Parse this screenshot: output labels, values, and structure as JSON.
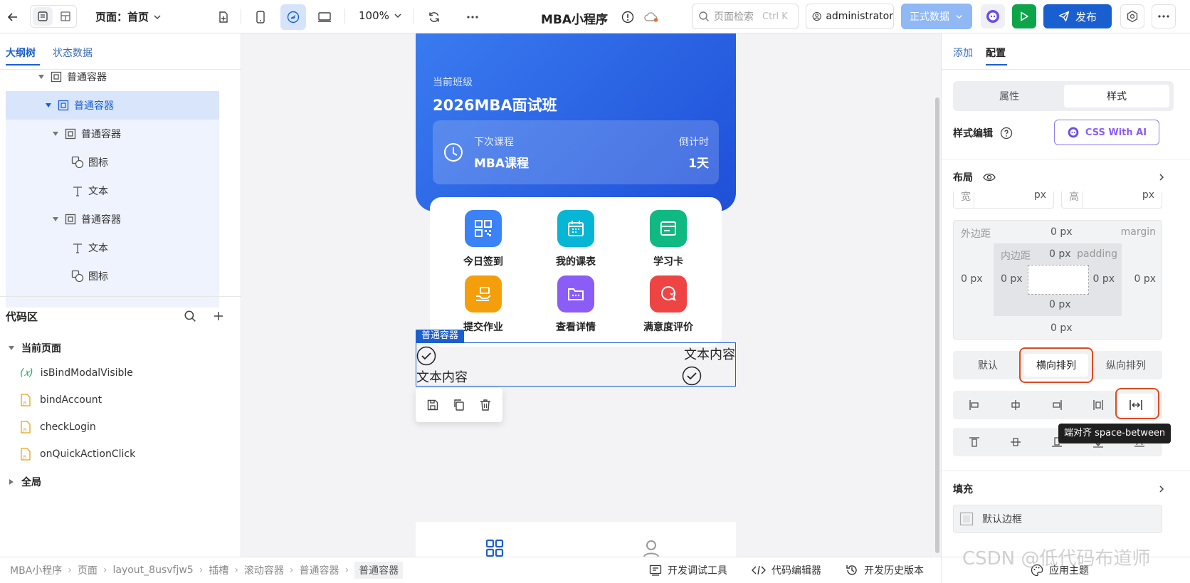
{
  "topbar": {
    "page_label": "页面：首页",
    "zoom": "100%",
    "app_title": "MBA小程序",
    "search_placeholder": "页面检索",
    "search_shortcut": "Ctrl K",
    "user": "administrator",
    "env": "正式数据",
    "publish": "发布"
  },
  "left": {
    "tabs": [
      "大纲树",
      "状态数据"
    ],
    "tree": [
      {
        "label": "普通容器",
        "icon": "container-icon"
      },
      {
        "label": "普通容器",
        "icon": "container-icon"
      },
      {
        "label": "普通容器",
        "icon": "container-icon"
      },
      {
        "label": "图标",
        "icon": "shapes-icon"
      },
      {
        "label": "文本",
        "icon": "text-icon"
      },
      {
        "label": "普通容器",
        "icon": "container-icon"
      },
      {
        "label": "文本",
        "icon": "text-icon"
      },
      {
        "label": "图标",
        "icon": "shapes-icon"
      }
    ],
    "code_title": "代码区",
    "code_page": "当前页面",
    "code_items": [
      {
        "label": "isBindModalVisible",
        "icon": "variable-icon"
      },
      {
        "label": "bindAccount",
        "icon": "js-file-icon"
      },
      {
        "label": "checkLogin",
        "icon": "js-file-icon"
      },
      {
        "label": "onQuickActionClick",
        "icon": "js-file-icon"
      }
    ],
    "code_global": "全局"
  },
  "canvas": {
    "class_label": "当前班级",
    "class_name": "2026MBA面试班",
    "next_label": "下次课程",
    "next_value": "MBA课程",
    "countdown_label": "倒计时",
    "countdown_value": "1天",
    "actions": [
      {
        "label": "今日签到",
        "color": "#3b82f6",
        "icon": "qrcode-icon"
      },
      {
        "label": "我的课表",
        "color": "#06b6d4",
        "icon": "calendar-icon"
      },
      {
        "label": "学习卡",
        "color": "#10b981",
        "icon": "card-icon"
      },
      {
        "label": "提交作业",
        "color": "#f59e0b",
        "icon": "submit-icon"
      },
      {
        "label": "查看详情",
        "color": "#8b5cf6",
        "icon": "folder-icon"
      },
      {
        "label": "满意度评价",
        "color": "#ef4444",
        "icon": "chat-icon"
      }
    ],
    "selected_tag": "普通容器",
    "text_content": "文本内容"
  },
  "right": {
    "tabs": [
      "添加",
      "配置"
    ],
    "seg": [
      "属性",
      "样式"
    ],
    "style_edit": "样式编辑",
    "css_ai": "CSS With AI",
    "layout": "布局",
    "width_label": "宽",
    "height_label": "高",
    "unit": "px",
    "margin_cn": "外边距",
    "margin_en": "margin",
    "padding_cn": "内边距",
    "padding_en": "padding",
    "zero_px": "0 px",
    "dir": [
      "默认",
      "横向排列",
      "纵向排列"
    ],
    "tooltip": "端对齐 space-between",
    "fill": "填充",
    "border": "默认边框"
  },
  "status": {
    "crumbs": [
      "MBA小程序",
      "页面",
      "layout_8usvfjw5",
      "插槽",
      "滚动容器",
      "普通容器",
      "普通容器"
    ],
    "devtools": "开发调试工具",
    "code_editor": "代码编辑器",
    "history": "开发历史版本",
    "theme": "应用主题",
    "watermark": "CSDN @低代码布道师"
  },
  "colors": {
    "primary": "#1a5fd0",
    "highlight": "#e04a1f",
    "banner": "#2563eb"
  }
}
